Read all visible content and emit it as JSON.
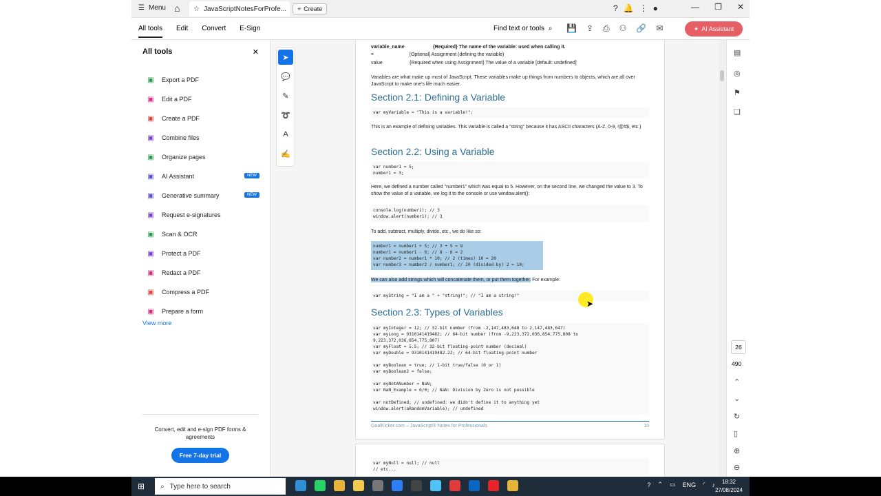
{
  "titlebar": {
    "menu_label": "Menu",
    "tab_title": "JavaScriptNotesForProfe...",
    "create_label": "Create"
  },
  "toolbar": {
    "menus": [
      "All tools",
      "Edit",
      "Convert",
      "E-Sign"
    ],
    "find_label": "Find text or tools",
    "ai_label": "AI Assistant"
  },
  "left_panel": {
    "title": "All tools",
    "items": [
      {
        "label": "Export a PDF",
        "color": "#2b9a52"
      },
      {
        "label": "Edit a PDF",
        "color": "#d62b7e"
      },
      {
        "label": "Create a PDF",
        "color": "#e0413d"
      },
      {
        "label": "Combine files",
        "color": "#7a3fd1"
      },
      {
        "label": "Organize pages",
        "color": "#2b9a52"
      },
      {
        "label": "AI Assistant",
        "color": "#5a4fcf",
        "badge": "NEW"
      },
      {
        "label": "Generative summary",
        "color": "#5a4fcf",
        "badge": "NEW"
      },
      {
        "label": "Request e-signatures",
        "color": "#7a3fd1"
      },
      {
        "label": "Scan & OCR",
        "color": "#2b9a52"
      },
      {
        "label": "Protect a PDF",
        "color": "#7a3fd1"
      },
      {
        "label": "Redact a PDF",
        "color": "#d62b7e"
      },
      {
        "label": "Compress a PDF",
        "color": "#e0413d"
      },
      {
        "label": "Prepare a form",
        "color": "#d62b7e"
      }
    ],
    "view_more": "View more",
    "promo": "Convert, edit and e-sign PDF forms & agreements",
    "trial_button": "Free 7-day trial"
  },
  "doc": {
    "params": [
      {
        "name": "variable_name",
        "desc": "{Required} The name of the variable: used when calling it."
      },
      {
        "name": "=",
        "desc": "[Optional] Assignment (defining the variable)"
      },
      {
        "name": "value",
        "desc": "{Required when using Assignment} The value of a variable [default: undefined]"
      }
    ],
    "intro": "Variables are what make up most of JavaScript. These variables make up things from numbers to objects, which are all over JavaScript to make one's life much easier.",
    "s21_title": "Section 2.1: Defining a Variable",
    "s21_code": "var myVariable = \"This is a variable!\";",
    "s21_text": "This is an example of defining variables. This variable is called a \"string\" because it has ASCII characters (A-Z, 0-9, !@#$, etc.)",
    "s22_title": "Section 2.2: Using a Variable",
    "s22_code": "var number1 = 5;\nnumber1 = 3;",
    "s22_text": "Here, we defined a number called \"number1\" which was equal to 5. However, on the second line, we changed the value to 3. To show the value of a variable, we log it to the console or use window.alert():",
    "s22_code2": "console.log(number1); // 3\nwindow.alert(number1); // 3",
    "s22_text2": "To add, subtract, multiply, divide, etc., we do like so:",
    "s22_code3": "number1 = number1 + 5; // 3 + 5 = 8\nnumber1 = number1 - 6; // 8 - 6 = 2\nvar number2 = number1 * 10; // 2 (times) 10 = 20\nvar number3 = number2 / number1; // 20 (divided by) 2 = 10;",
    "s22_text3_sel": "We can also add strings which will concatenate them, or put them together.",
    "s22_text3_rest": " For example:",
    "s22_code4": "var myString = \"I am a \" + \"string!\"; // \"I am a string!\"",
    "s23_title": "Section 2.3: Types of Variables",
    "s23_code": "var myInteger = 12; // 32-bit number (from -2,147,483,648 to 2,147,483,647)\nvar myLong = 9310141419482; // 64-bit number (from -9,223,372,036,854,775,808 to\n9,223,372,036,854,775,807)\nvar myFloat = 5.5; // 32-bit floating-point number (decimal)\nvar myDouble = 9310141419482.22; // 64-bit floating-point number\n\nvar myBoolean = true; // 1-bit true/false (0 or 1)\nvar myBoolean2 = false;\n\nvar myNotANumber = NaN;\nvar NaN_Example = 0/0; // NaN: Division by Zero is not possible\n\nvar notDefined; // undefined: we didn't define it to anything yet\nwindow.alert(aRandomVariable); // undefined",
    "footer_left": "GoalKicker.com – JavaScript® Notes for Professionals",
    "footer_right": "10",
    "p2_code": "var myNull = null; // null\n// etc..."
  },
  "rail": {
    "page_number": "26",
    "total_pages": "490"
  },
  "taskbar": {
    "search_placeholder": "Type here to search",
    "lang": "ENG",
    "time": "18:32",
    "date": "27/08/2024"
  }
}
